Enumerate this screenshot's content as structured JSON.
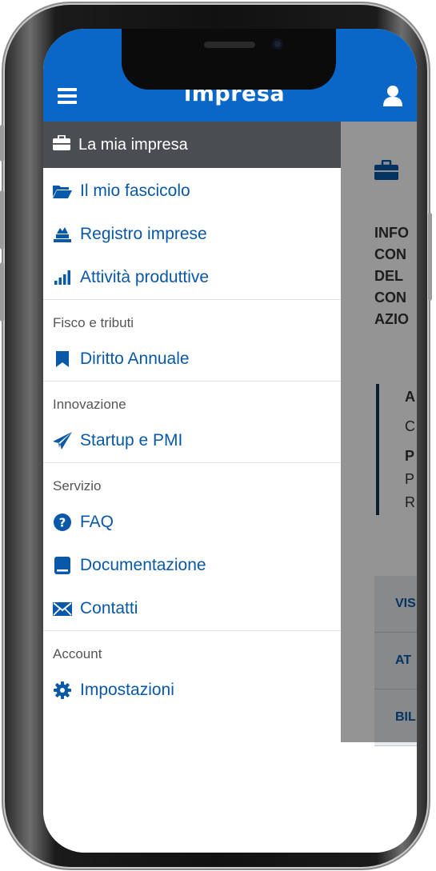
{
  "app": {
    "brand": "impresa"
  },
  "drawer": {
    "header_label": "La mia impresa",
    "main_items": [
      {
        "label": "Il mio fascicolo",
        "icon": "folder-open-icon"
      },
      {
        "label": "Registro imprese",
        "icon": "registry-icon"
      },
      {
        "label": "Attività produttive",
        "icon": "bar-chart-icon"
      }
    ],
    "sections": [
      {
        "title": "Fisco e tributi",
        "items": [
          {
            "label": "Diritto Annuale",
            "icon": "bookmark-icon"
          }
        ]
      },
      {
        "title": "Innovazione",
        "items": [
          {
            "label": "Startup e PMI",
            "icon": "paper-plane-icon"
          }
        ]
      },
      {
        "title": "Servizio",
        "items": [
          {
            "label": "FAQ",
            "icon": "question-circle-icon"
          },
          {
            "label": "Documentazione",
            "icon": "book-icon"
          },
          {
            "label": "Contatti",
            "icon": "envelope-icon"
          }
        ]
      },
      {
        "title": "Account",
        "items": [
          {
            "label": "Impostazioni",
            "icon": "gear-icon"
          }
        ]
      }
    ]
  },
  "background_page": {
    "title_lines": [
      "INFO",
      "CON",
      "DEL",
      "CON",
      "AZIO"
    ],
    "detail_lines": [
      "A",
      "C",
      "P",
      "P",
      "R"
    ],
    "tabs": [
      "VIS",
      "AT",
      "BIL"
    ]
  },
  "colors": {
    "primary": "#0a67c8",
    "link": "#0a58a8",
    "drawer_header": "#4a4e53"
  }
}
